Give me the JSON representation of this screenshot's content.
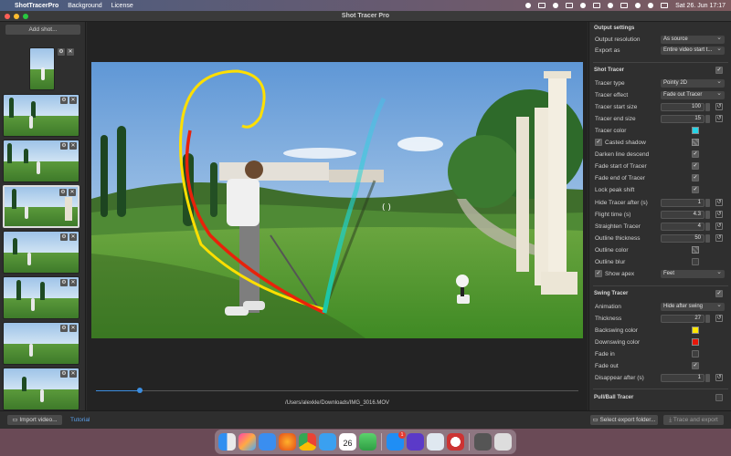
{
  "menubar": {
    "app_name": "ShotTracerPro",
    "items": [
      "Background",
      "License"
    ],
    "clock": "Sat 26. Jun  17:17"
  },
  "window": {
    "title": "Shot Tracer Pro"
  },
  "sidebar": {
    "add_shot_label": "Add shot..."
  },
  "video": {
    "file_path": "/Users/alexkle/Downloads/IMG_3016.MOV",
    "progress": 0.09
  },
  "panel": {
    "output_settings": {
      "heading": "Output settings",
      "resolution_label": "Output resolution",
      "resolution_value": "As source",
      "export_label": "Export as",
      "export_value": "Entire video start t..."
    },
    "shot_tracer": {
      "heading": "Shot Tracer",
      "enabled": true,
      "tracer_type_label": "Tracer type",
      "tracer_type_value": "Pointy 2D",
      "tracer_effect_label": "Tracer effect",
      "tracer_effect_value": "Fade out Tracer",
      "start_size_label": "Tracer start size",
      "start_size_value": "100",
      "end_size_label": "Tracer end size",
      "end_size_value": "15",
      "color_label": "Tracer color",
      "color_hex": "#27d3e6",
      "casted_shadow_label": "Casted shadow",
      "darken_label": "Darken line descend",
      "fade_start_label": "Fade start of Tracer",
      "fade_end_label": "Fade end of Tracer",
      "lock_peak_label": "Lock peak shift",
      "hide_after_label": "Hide Tracer after (s)",
      "hide_after_value": "1",
      "flight_time_label": "Flight time (s)",
      "flight_time_value": "4.3",
      "straighten_label": "Straighten Tracer",
      "straighten_value": "4",
      "outline_thickness_label": "Outline thickness",
      "outline_thickness_value": "50",
      "outline_color_label": "Outline color",
      "outline_blur_label": "Outline blur",
      "show_apex_label": "Show apex",
      "show_apex_value": "Feet"
    },
    "swing_tracer": {
      "heading": "Swing Tracer",
      "animation_label": "Animation",
      "animation_value": "Hide after swing",
      "thickness_label": "Thickness",
      "thickness_value": "27",
      "backswing_label": "Backswing color",
      "backswing_hex": "#ffe600",
      "downswing_label": "Downswing color",
      "downswing_hex": "#e8170a",
      "fade_in_label": "Fade in",
      "fade_out_label": "Fade out",
      "disappear_label": "Disappear after (s)",
      "disappear_value": "1"
    },
    "pull_ball": {
      "heading": "Pull/Ball Tracer"
    }
  },
  "bottombar": {
    "import_label": "Import video...",
    "tutorial_label": "Tutorial",
    "select_folder_label": "Select export folder...",
    "trace_export_label": "Trace and export"
  },
  "dock": {
    "calendar_day": "26",
    "appstore_badge": "1"
  }
}
